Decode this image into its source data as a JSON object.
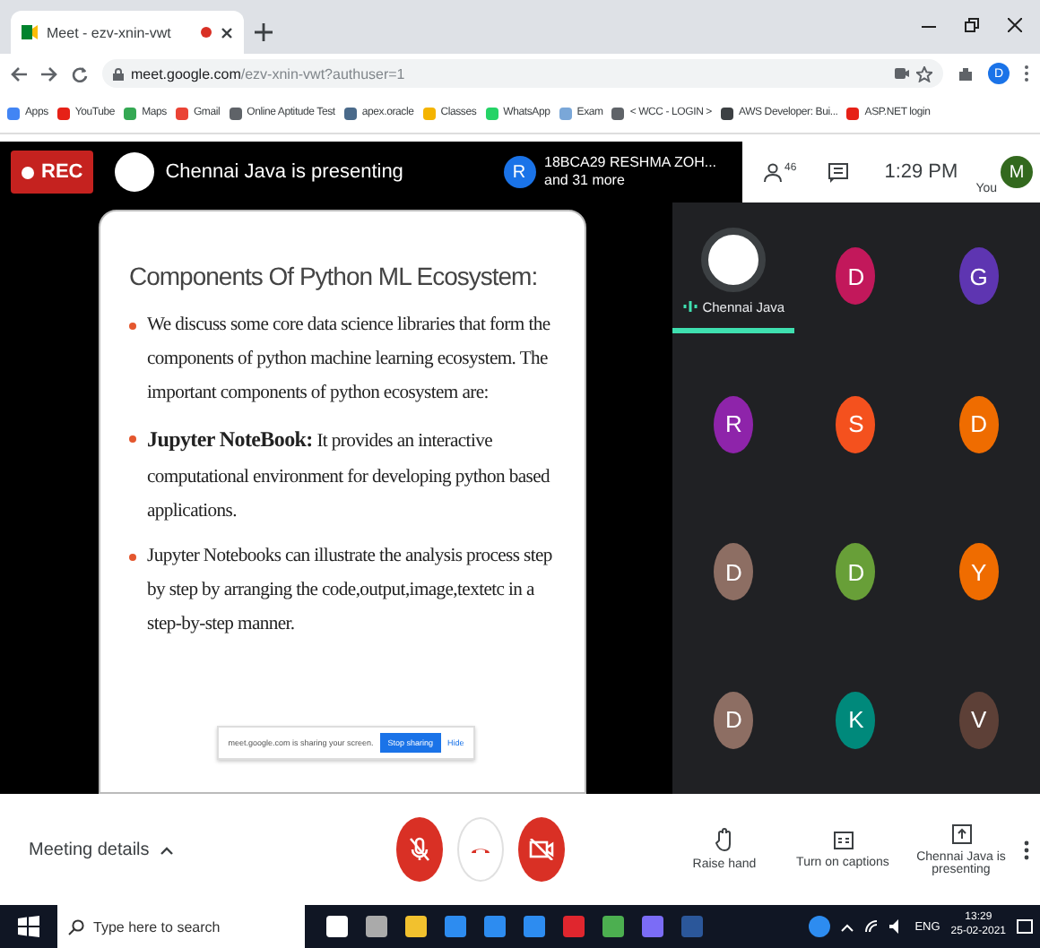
{
  "browser": {
    "tab": {
      "title": "Meet - ezv-xnin-vwt",
      "recording": true
    },
    "address": {
      "host": "meet.google.com",
      "path": "/ezv-xnin-vwt?authuser=1"
    },
    "profile": "D",
    "bookmarks": [
      {
        "label": "Apps",
        "color": "#4285f4"
      },
      {
        "label": "YouTube",
        "color": "#e62117"
      },
      {
        "label": "Maps",
        "color": "#34a853"
      },
      {
        "label": "Gmail",
        "color": "#ea4335"
      },
      {
        "label": "Online Aptitude Test",
        "color": "#5f6368"
      },
      {
        "label": "apex.oracle",
        "color": "#4a6a8a"
      },
      {
        "label": "Classes",
        "color": "#f4b400"
      },
      {
        "label": "WhatsApp",
        "color": "#25d366"
      },
      {
        "label": "Exam",
        "color": "#7aa7d8"
      },
      {
        "label": "< WCC - LOGIN >",
        "color": "#5f6368"
      },
      {
        "label": "AWS Developer: Bui...",
        "color": "#3c4043"
      },
      {
        "label": "ASP.NET login",
        "color": "#e62117"
      }
    ]
  },
  "meet_header": {
    "rec": "REC",
    "presenter": "Chennai Java is presenting",
    "participants": {
      "avatar": "R",
      "name": "18BCA29 RESHMA ZOH...",
      "more": "and 31 more",
      "count": "46"
    },
    "time": "1:29 PM",
    "self": {
      "label": "You",
      "avatar": "M"
    }
  },
  "slide": {
    "title": "Components Of Python ML Ecosystem:",
    "bullets": [
      "We discuss some core data science libraries that form the components of python machine learning ecosystem. The important components of python ecosystem are:",
      "**Jupyter NoteBook:** It provides an interactive computational environment for developing python based applications.",
      "Jupyter Notebooks can illustrate the analysis process step by step by arranging the code,output,image,textetc in a step-by-step manner."
    ],
    "share_bar": {
      "message": "meet.google.com is sharing your screen.",
      "stop": "Stop sharing",
      "hide": "Hide"
    }
  },
  "tiles": [
    {
      "kind": "logo",
      "name": "Chennai Java",
      "speaking": true
    },
    {
      "kind": "letter",
      "letter": "D",
      "color": "#c2185b"
    },
    {
      "kind": "letter",
      "letter": "G",
      "color": "#5e35b1"
    },
    {
      "kind": "letter",
      "letter": "R",
      "color": "#8e24aa"
    },
    {
      "kind": "letter",
      "letter": "S",
      "color": "#f4511e"
    },
    {
      "kind": "letter",
      "letter": "D",
      "color": "#ef6c00"
    },
    {
      "kind": "letter",
      "letter": "D",
      "color": "#8d6e63"
    },
    {
      "kind": "letter",
      "letter": "D",
      "color": "#689f38"
    },
    {
      "kind": "letter",
      "letter": "Y",
      "color": "#ef6c00"
    },
    {
      "kind": "letter",
      "letter": "D",
      "color": "#8d6e63"
    },
    {
      "kind": "letter",
      "letter": "K",
      "color": "#00897b"
    },
    {
      "kind": "letter",
      "letter": "V",
      "color": "#5d4037"
    }
  ],
  "controls": {
    "meeting_details": "Meeting details",
    "mic": {
      "on": false
    },
    "camera": {
      "on": false
    },
    "actions": [
      {
        "kind": "hand",
        "label": "Raise hand"
      },
      {
        "kind": "captions",
        "label": "Turn on captions"
      },
      {
        "kind": "present",
        "label": "Chennai Java is presenting"
      }
    ]
  },
  "taskbar": {
    "search_placeholder": "Type here to search",
    "language": "ENG",
    "time": "13:29",
    "date": "25-02-2021"
  }
}
